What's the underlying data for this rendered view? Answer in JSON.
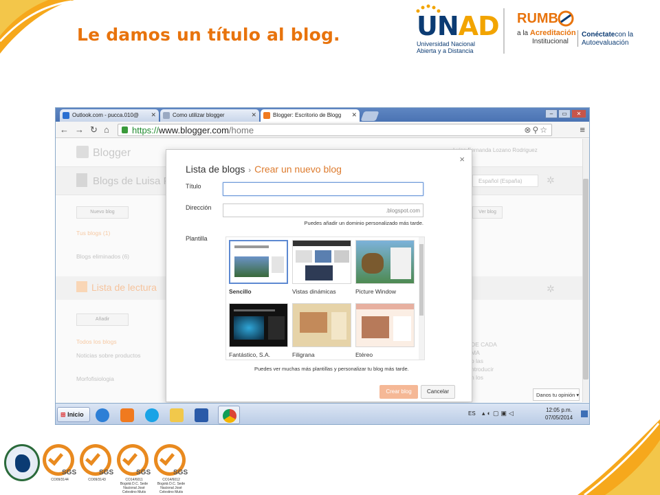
{
  "slide": {
    "title": "Le damos un título al blog.",
    "colors": {
      "accent": "#e8730c",
      "unad_blue": "#0b3b73",
      "unad_yellow": "#f2a400"
    }
  },
  "logos": {
    "unad": {
      "u": "U",
      "n": "N",
      "ad": "AD",
      "line1": "Universidad Nacional",
      "line2": "Abierta y a  Distancia"
    },
    "rumbo": {
      "word": "RUMB",
      "line1_prefix": "a la",
      "line1_bold": "Acreditación",
      "line2": "Institucional",
      "right_bold": "Conéctate",
      "right_rest": "con la",
      "right_line2": "Autoevaluación"
    }
  },
  "browser": {
    "tabs": [
      {
        "label": "Outlook.com - pucca.010@",
        "icon": "outlook-icon",
        "color": "#2a6fd1"
      },
      {
        "label": "Como utilizar blogger",
        "icon": "page-icon",
        "color": "#9aa9c2"
      },
      {
        "label": "Blogger: Escritorio de Blogg",
        "icon": "blogger-icon",
        "color": "#f07a1f"
      }
    ],
    "window_buttons": [
      "–",
      "▭",
      "✕"
    ],
    "url_https": "https://",
    "url_host": "www.blogger.com",
    "url_path": "/home"
  },
  "background": {
    "logo": "Blogger",
    "user": "Luisa Fernanda Lozano Rodriguez",
    "blogs_heading": "Blogs de Luisa F",
    "language": "Español (España)",
    "new_blog_btn": "Nuevo blog",
    "ver_blog_btn": "Ver blog",
    "tus_blogs": "Tus blogs (1)",
    "eliminados": "Blogs eliminados (6)",
    "lectura": "Lista de lectura",
    "anadir_btn": "Añadir",
    "todos": "Todos los blogs",
    "noticias": "Noticias sobre productos",
    "morfo": "Morfofisiologia",
    "right_snippet": [
      "DE CADA",
      "MA",
      "o las",
      "ntroducir",
      "n los"
    ],
    "feedback": "Danos tu opinión"
  },
  "dialog": {
    "crumb_list": "Lista de blogs",
    "crumb_separator": "›",
    "crumb_new": "Crear un nuevo blog",
    "title_label": "Título",
    "title_value": "",
    "address_label": "Dirección",
    "address_value": "",
    "address_suffix": ".blogspot.com",
    "address_hint": "Puedes añadir un dominio personalizado más tarde.",
    "template_label": "Plantilla",
    "templates": [
      {
        "name": "Sencillo",
        "selected": true
      },
      {
        "name": "Vistas dinámicas",
        "selected": false
      },
      {
        "name": "Picture Window",
        "selected": false
      },
      {
        "name": "Fantástico, S.A.",
        "selected": false
      },
      {
        "name": "Filigrana",
        "selected": false
      },
      {
        "name": "Etéreo",
        "selected": false
      }
    ],
    "more_templates": "Puedes ver muchas más plantillas y personalizar tu blog más tarde.",
    "create_btn": "Crear blog",
    "cancel_btn": "Cancelar",
    "close": "×"
  },
  "taskbar": {
    "start": "Inicio",
    "apps": [
      "internet-explorer-icon",
      "media-player-icon",
      "skype-icon",
      "folder-icon",
      "word-icon",
      "chrome-icon"
    ],
    "lang": "ES",
    "time": "12:05 p.m.",
    "date": "07/05/2014"
  },
  "certifications": {
    "sgs": "SGS",
    "codes": [
      "CO09/3144",
      "CO09/3143",
      "CO14/6011\nBogotá D.C. Sede\nNacional José\nCelestino Mutis",
      "CO14/6012\nBogotá D.C. Sede\nNacional José\nCelestino Mutis"
    ]
  }
}
